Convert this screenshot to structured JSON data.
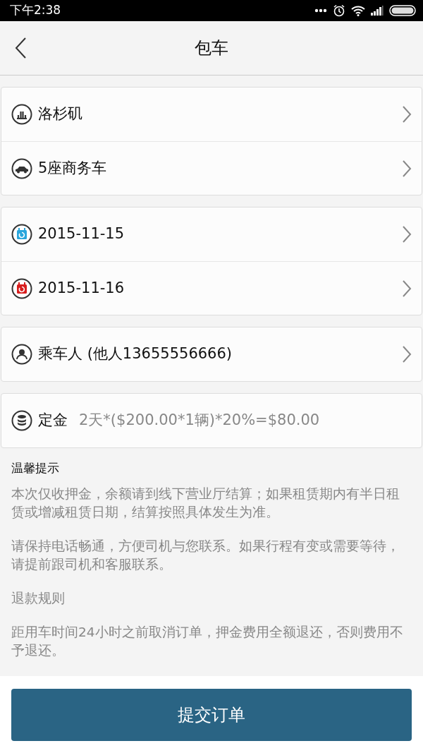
{
  "status_bar": {
    "time": "下午2:38"
  },
  "header": {
    "title": "包车"
  },
  "groups": [
    {
      "rows": [
        {
          "kind": "place",
          "label": "洛杉矶",
          "chevron": true
        },
        {
          "kind": "car",
          "label": "5座商务车",
          "chevron": true
        }
      ]
    },
    {
      "rows": [
        {
          "kind": "start-date",
          "label": "2015-11-15",
          "chevron": true
        },
        {
          "kind": "end-date",
          "label": "2015-11-16",
          "chevron": true
        }
      ]
    },
    {
      "rows": [
        {
          "kind": "passenger",
          "label": "乘车人 (他人13655556666)",
          "chevron": true
        }
      ]
    },
    {
      "rows": [
        {
          "kind": "deposit",
          "label": "定金",
          "value": "2天*($200.00*1辆)*20%=$80.00",
          "chevron": false
        }
      ]
    }
  ],
  "notes": {
    "title": "温馨提示",
    "paragraphs": [
      "本次仅收押金，余额请到线下营业厅结算；如果租赁期内有半日租赁或增减租赁日期，结算按照具体发生为准。",
      "请保持电话畅通，方便司机与您联系。如果行程有变或需要等待，请提前跟司机和客服联系。",
      "退款规则",
      "距用车时间24小时之前取消订单，押金费用全额退还，否则费用不予退还。"
    ]
  },
  "submit_button": "提交订单"
}
